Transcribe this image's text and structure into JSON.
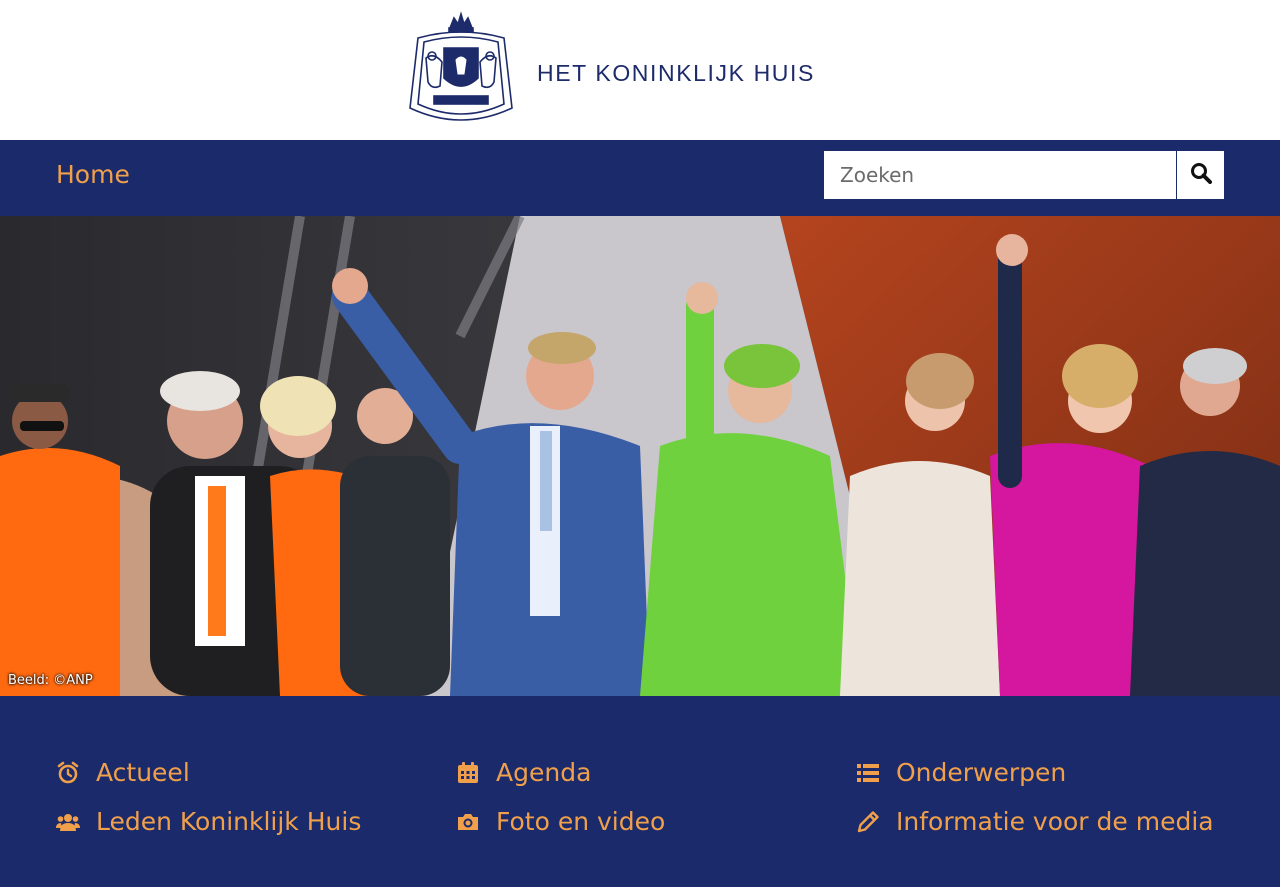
{
  "header": {
    "brand": "HET KONINKLIJK HUIS",
    "logo_icon": "coat-of-arms-icon"
  },
  "nav": {
    "home": "Home",
    "search_placeholder": "Zoeken",
    "search_icon": "search-icon"
  },
  "hero": {
    "credit": "Beeld: ©ANP"
  },
  "links": [
    {
      "label": "Actueel",
      "icon": "alarm-clock-icon"
    },
    {
      "label": "Agenda",
      "icon": "calendar-icon"
    },
    {
      "label": "Onderwerpen",
      "icon": "list-icon"
    },
    {
      "label": "Leden Koninklijk Huis",
      "icon": "users-icon"
    },
    {
      "label": "Foto en video",
      "icon": "camera-icon"
    },
    {
      "label": "Informatie voor de media",
      "icon": "pencil-icon"
    }
  ],
  "colors": {
    "navy": "#1b2a6b",
    "orange": "#f0a04b",
    "white": "#ffffff"
  }
}
